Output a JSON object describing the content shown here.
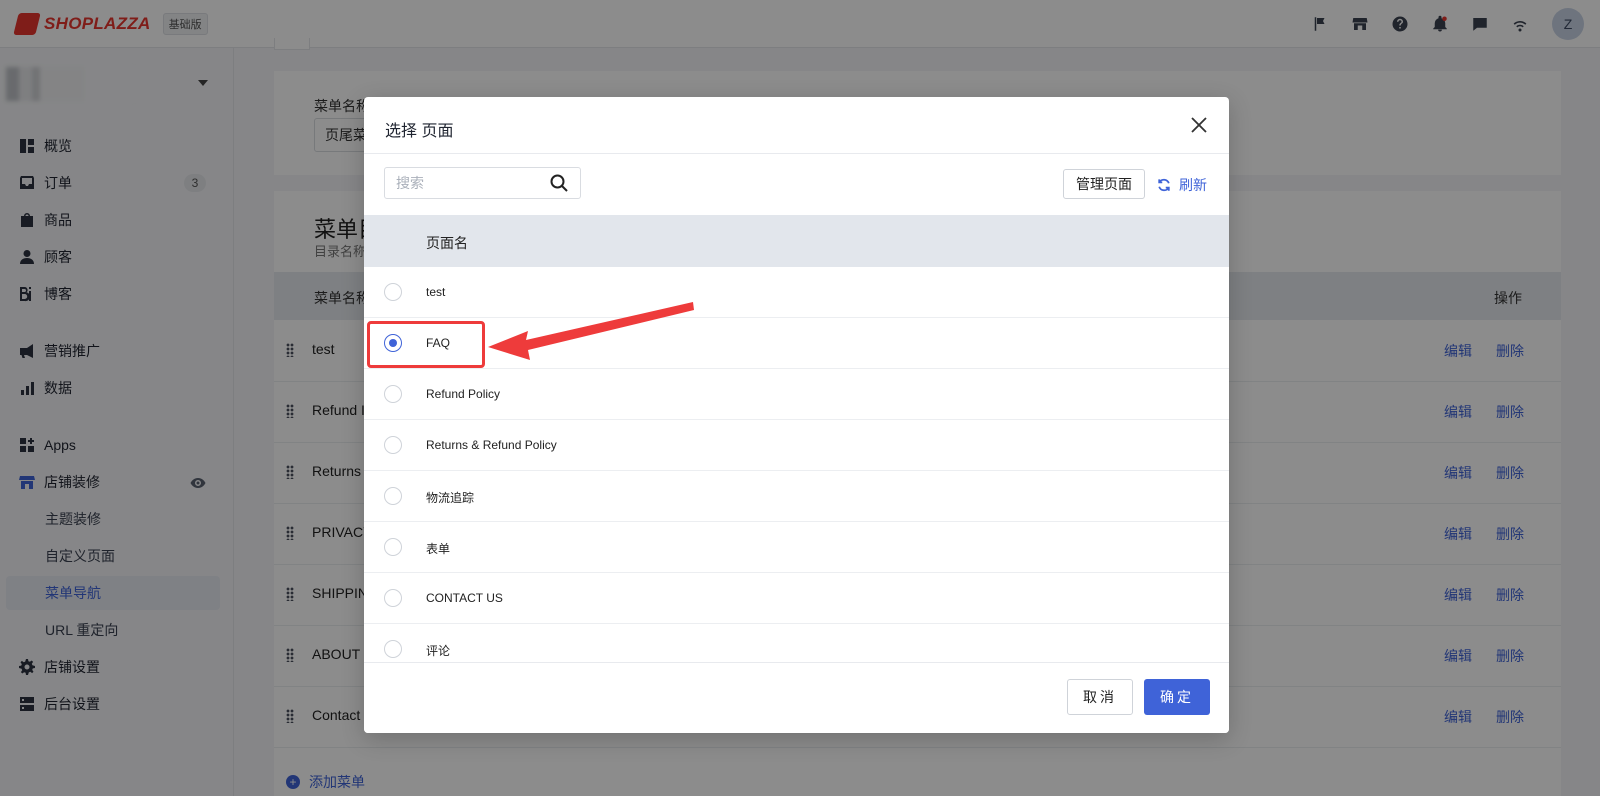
{
  "topbar": {
    "brand": "SHOPLAZZA",
    "plan": "基础版",
    "avatar_initial": "Z",
    "icons": [
      "flag-icon",
      "store-icon",
      "help-icon",
      "bell-icon",
      "message-icon",
      "wifi-icon"
    ]
  },
  "sidebar": {
    "items": [
      {
        "label": "概览",
        "icon": "overview-icon"
      },
      {
        "label": "订单",
        "icon": "inbox-icon",
        "badge": "3"
      },
      {
        "label": "商品",
        "icon": "bag-icon"
      },
      {
        "label": "顾客",
        "icon": "user-icon"
      },
      {
        "label": "博客",
        "icon": "blog-icon"
      },
      {
        "label": "营销推广",
        "icon": "megaphone-icon"
      },
      {
        "label": "数据",
        "icon": "bar-chart-icon"
      },
      {
        "label": "Apps",
        "icon": "apps-icon"
      },
      {
        "label": "店铺装修",
        "icon": "storefront-icon"
      },
      {
        "label": "主题装修"
      },
      {
        "label": "自定义页面"
      },
      {
        "label": "菜单导航"
      },
      {
        "label": "URL 重定向"
      },
      {
        "label": "店铺设置",
        "icon": "gear-icon"
      },
      {
        "label": "后台设置",
        "icon": "server-icon"
      }
    ]
  },
  "background": {
    "menu_name_label": "菜单名称",
    "menu_name_value": "页尾菜",
    "section_title": "菜单目",
    "section_sub": "目录名称",
    "col_name": "菜单名称",
    "col_action": "操作",
    "rows": [
      "test",
      "Refund I",
      "Returns",
      "PRIVACY",
      "SHIPPIN",
      "ABOUT",
      "Contact"
    ],
    "edit_label": "编辑",
    "delete_label": "删除",
    "add_menu": "添加菜单"
  },
  "modal": {
    "title": "选择 页面",
    "search_placeholder": "搜索",
    "manage_button": "管理页面",
    "refresh_button": "刷新",
    "column_header": "页面名",
    "rows": [
      {
        "label": "test",
        "selected": false
      },
      {
        "label": "FAQ",
        "selected": true
      },
      {
        "label": "Refund Policy",
        "selected": false
      },
      {
        "label": "Returns & Refund Policy",
        "selected": false
      },
      {
        "label": "物流追踪",
        "selected": false
      },
      {
        "label": "表单",
        "selected": false
      },
      {
        "label": "CONTACT US",
        "selected": false
      },
      {
        "label": "评论",
        "selected": false
      }
    ],
    "cancel_button": "取消",
    "ok_button": "确定"
  },
  "colors": {
    "accent": "#3f63d8",
    "annotation": "#ee3b3b",
    "brand": "#e8352e"
  }
}
